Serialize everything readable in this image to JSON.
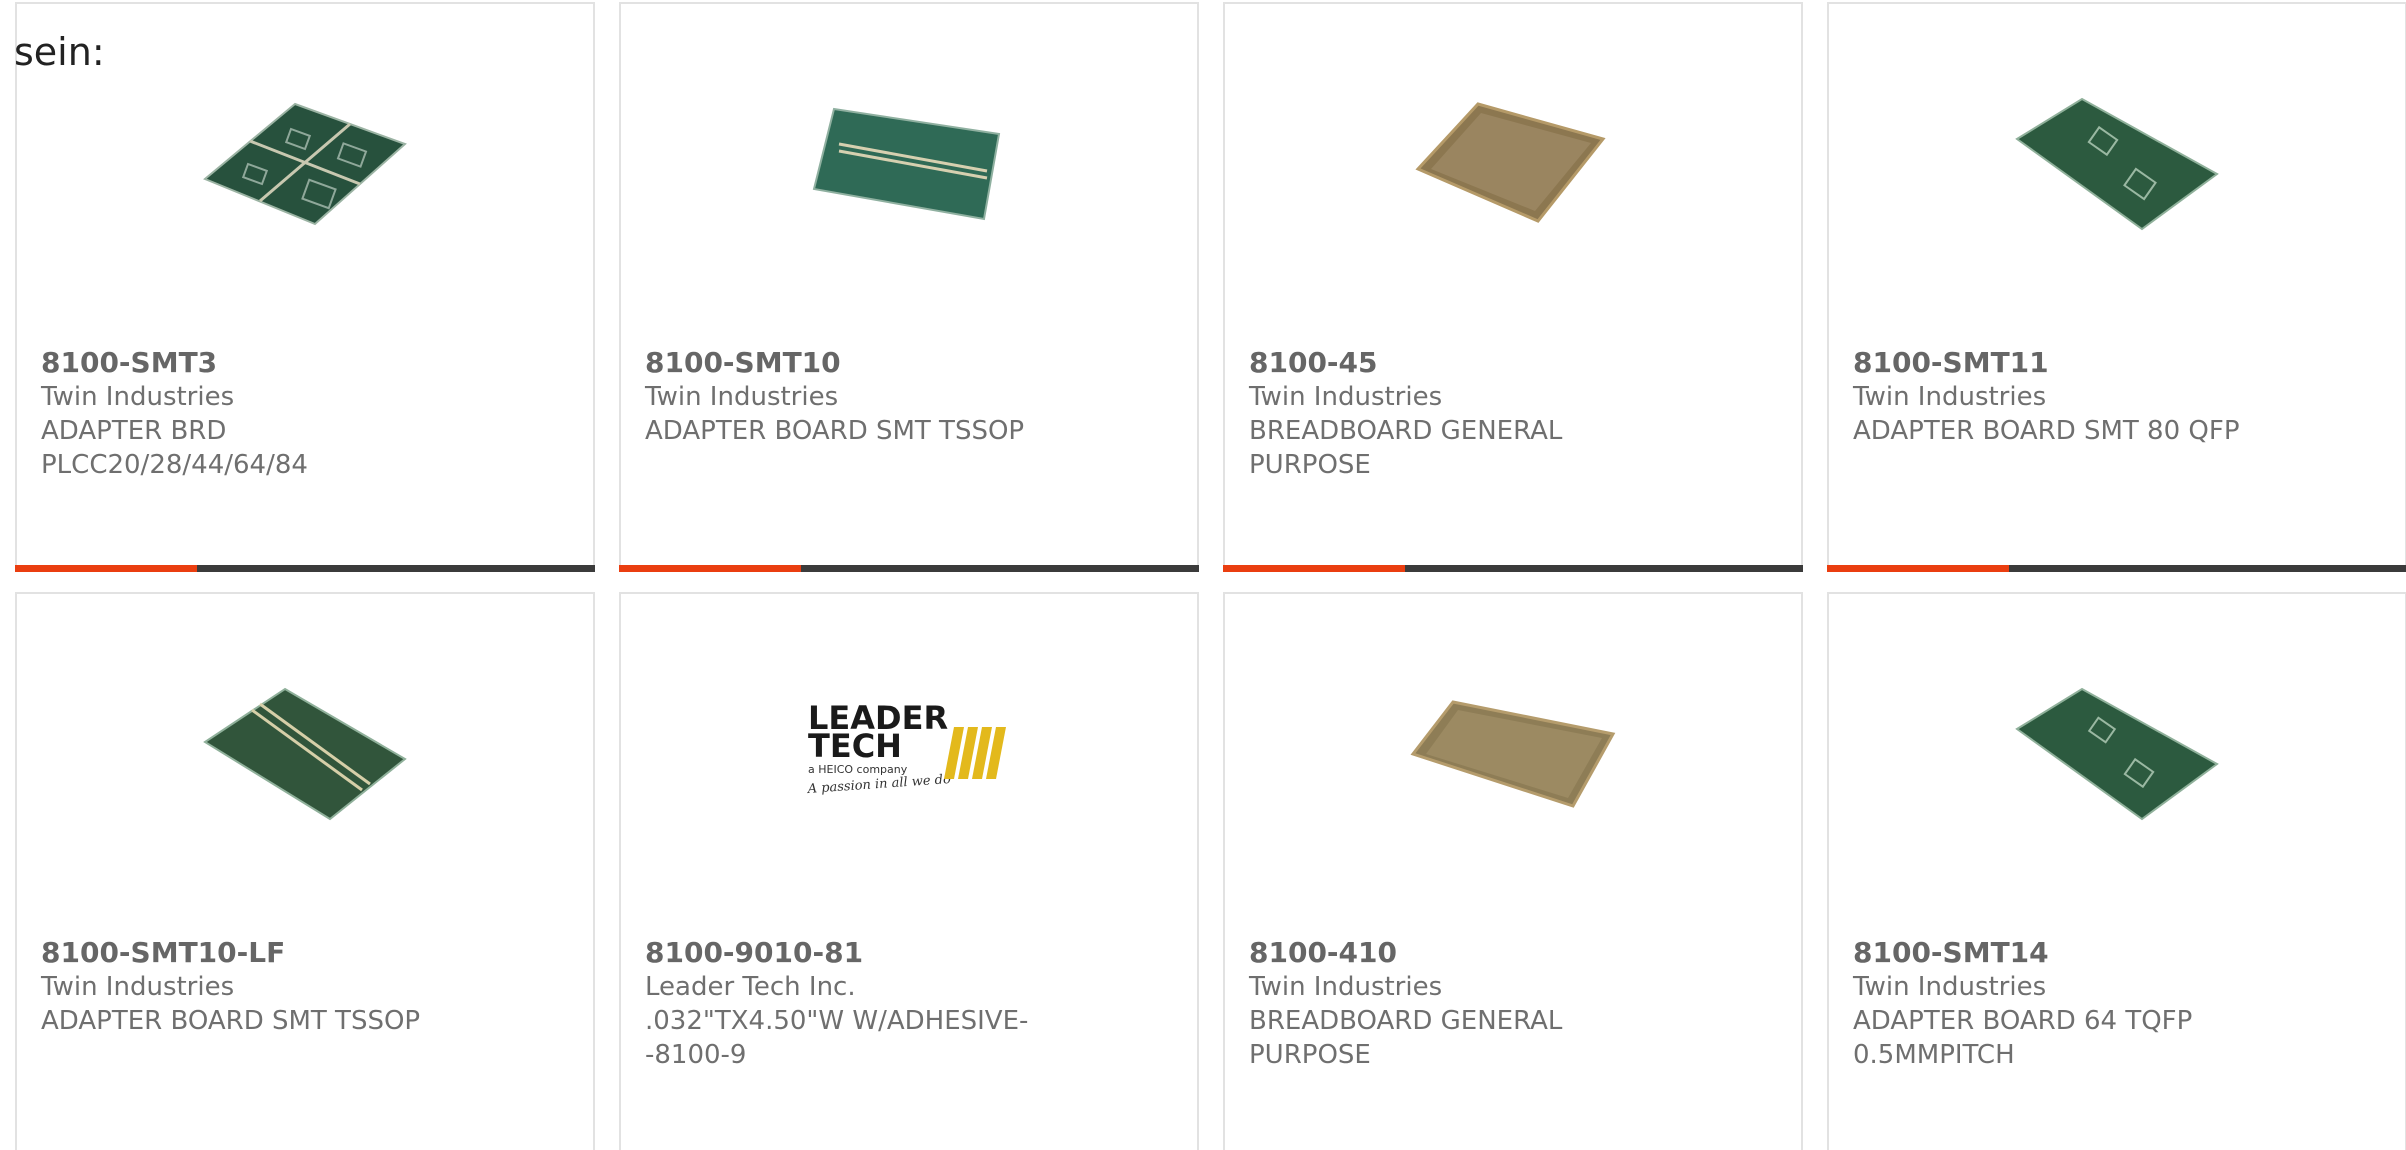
{
  "intro_text": "sein:",
  "colors": {
    "accent_bar": "#ea3e10",
    "dark_bar": "#3b3b3b",
    "text": "#6f6f6f",
    "card_border": "#e2e2e2"
  },
  "products": [
    {
      "part": "8100-SMT3",
      "maker": "Twin Industries",
      "desc": "ADAPTER BRD PLCC20/28/44/64/84",
      "image": "green-adapter-board-4-quad"
    },
    {
      "part": "8100-SMT10",
      "maker": "Twin Industries",
      "desc": "ADAPTER BOARD SMT TSSOP",
      "image": "green-adapter-board-strip"
    },
    {
      "part": "8100-45",
      "maker": "Twin Industries",
      "desc": "BREADBOARD GENERAL PURPOSE",
      "image": "tan-breadboard"
    },
    {
      "part": "8100-SMT11",
      "maker": "Twin Industries",
      "desc": "ADAPTER BOARD SMT 80 QFP",
      "image": "green-adapter-board-2-qfp"
    },
    {
      "part": "8100-SMT10-LF",
      "maker": "Twin Industries",
      "desc": "ADAPTER BOARD SMT TSSOP",
      "image": "green-adapter-board-strip-lf"
    },
    {
      "part": "8100-9010-81",
      "maker": "Leader Tech Inc.",
      "desc": ".032\"TX4.50\"W W/ADHESIVE--8100-9",
      "image": "leader-tech-logo"
    },
    {
      "part": "8100-410",
      "maker": "Twin Industries",
      "desc": "BREADBOARD GENERAL PURPOSE",
      "image": "tan-breadboard-long"
    },
    {
      "part": "8100-SMT14",
      "maker": "Twin Industries",
      "desc": "ADAPTER BOARD 64 TQFP 0.5MMPITCH",
      "image": "green-adapter-board-2-tqfp"
    }
  ],
  "logo": {
    "line1": "LEADER",
    "line2": "TECH",
    "tagline": "a HEICO company",
    "slogan": "A passion in all we do"
  }
}
